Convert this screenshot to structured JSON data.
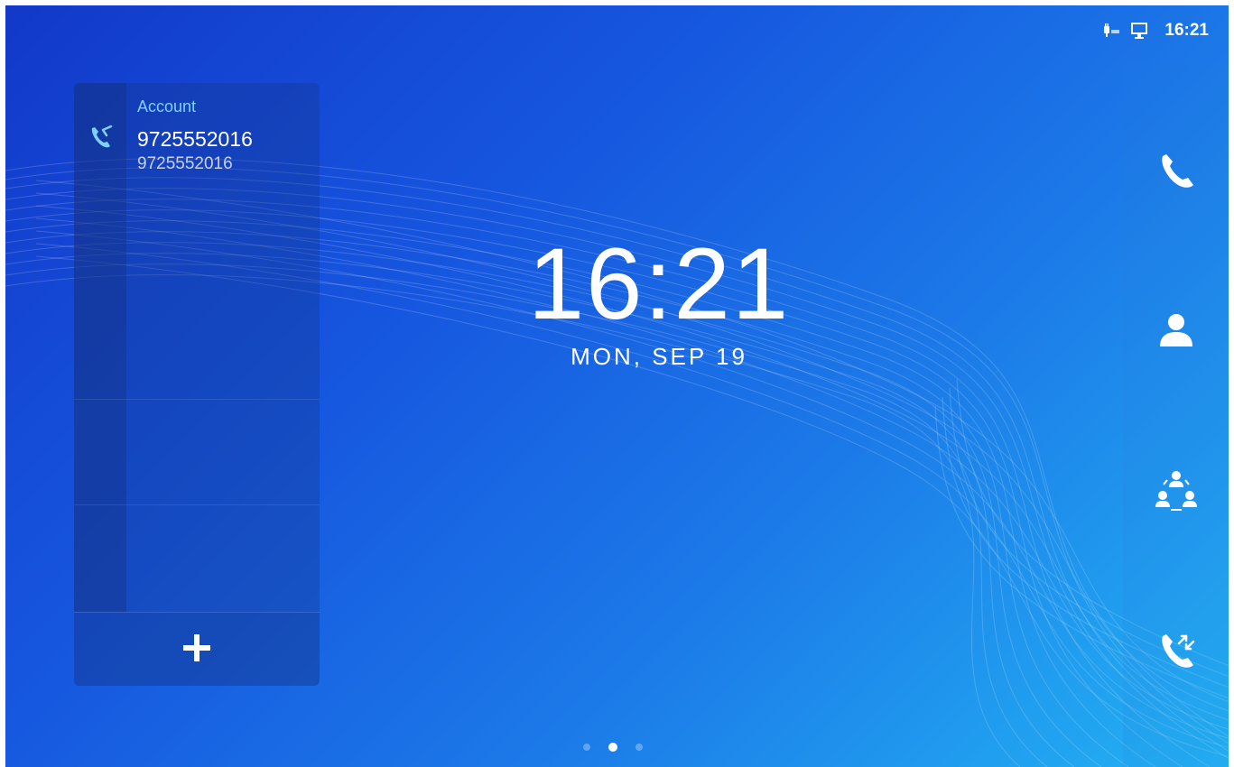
{
  "status": {
    "time": "16:21",
    "icons": [
      "poe-power-icon",
      "network-connected-icon"
    ]
  },
  "account": {
    "label": "Account",
    "name": "9725552016",
    "number": "9725552016",
    "icon": "phone-account-icon"
  },
  "add_account": {
    "icon": "plus-icon"
  },
  "clock": {
    "time": "16:21",
    "date": "MON, SEP 19"
  },
  "dock": [
    {
      "name": "dial-button",
      "icon": "phone-icon"
    },
    {
      "name": "contacts-button",
      "icon": "contact-icon"
    },
    {
      "name": "conference-button",
      "icon": "conference-icon"
    },
    {
      "name": "call-history-button",
      "icon": "call-history-icon"
    }
  ],
  "pages": {
    "count": 3,
    "active": 2
  }
}
